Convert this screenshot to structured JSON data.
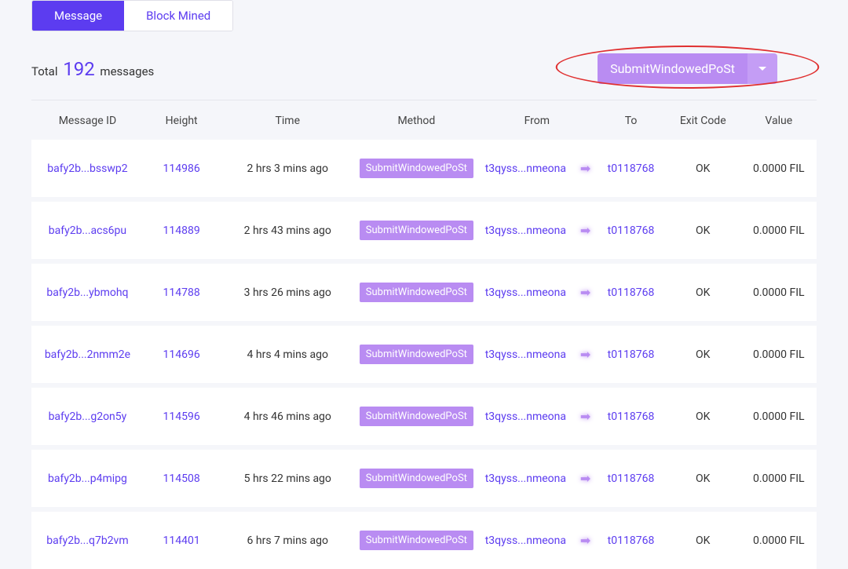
{
  "tabs": {
    "message": "Message",
    "block_mined": "Block Mined"
  },
  "summary": {
    "total_prefix": "Total ",
    "total_count": "192",
    "total_suffix": " messages"
  },
  "filter": {
    "selected": "SubmitWindowedPoSt"
  },
  "table": {
    "headers": {
      "message_id": "Message ID",
      "height": "Height",
      "time": "Time",
      "method": "Method",
      "from": "From",
      "to": "To",
      "exit_code": "Exit Code",
      "value": "Value"
    },
    "rows": [
      {
        "message_id": "bafy2b...bsswp2",
        "height": "114986",
        "time": "2 hrs 3 mins ago",
        "method": "SubmitWindowedPoSt",
        "from": "t3qyss...nmeona",
        "to": "t0118768",
        "exit_code": "OK",
        "value": "0.0000 FIL"
      },
      {
        "message_id": "bafy2b...acs6pu",
        "height": "114889",
        "time": "2 hrs 43 mins ago",
        "method": "SubmitWindowedPoSt",
        "from": "t3qyss...nmeona",
        "to": "t0118768",
        "exit_code": "OK",
        "value": "0.0000 FIL"
      },
      {
        "message_id": "bafy2b...ybmohq",
        "height": "114788",
        "time": "3 hrs 26 mins ago",
        "method": "SubmitWindowedPoSt",
        "from": "t3qyss...nmeona",
        "to": "t0118768",
        "exit_code": "OK",
        "value": "0.0000 FIL"
      },
      {
        "message_id": "bafy2b...2nmm2e",
        "height": "114696",
        "time": "4 hrs 4 mins ago",
        "method": "SubmitWindowedPoSt",
        "from": "t3qyss...nmeona",
        "to": "t0118768",
        "exit_code": "OK",
        "value": "0.0000 FIL"
      },
      {
        "message_id": "bafy2b...g2on5y",
        "height": "114596",
        "time": "4 hrs 46 mins ago",
        "method": "SubmitWindowedPoSt",
        "from": "t3qyss...nmeona",
        "to": "t0118768",
        "exit_code": "OK",
        "value": "0.0000 FIL"
      },
      {
        "message_id": "bafy2b...p4mipg",
        "height": "114508",
        "time": "5 hrs 22 mins ago",
        "method": "SubmitWindowedPoSt",
        "from": "t3qyss...nmeona",
        "to": "t0118768",
        "exit_code": "OK",
        "value": "0.0000 FIL"
      },
      {
        "message_id": "bafy2b...q7b2vm",
        "height": "114401",
        "time": "6 hrs 7 mins ago",
        "method": "SubmitWindowedPoSt",
        "from": "t3qyss...nmeona",
        "to": "t0118768",
        "exit_code": "OK",
        "value": "0.0000 FIL"
      }
    ]
  }
}
